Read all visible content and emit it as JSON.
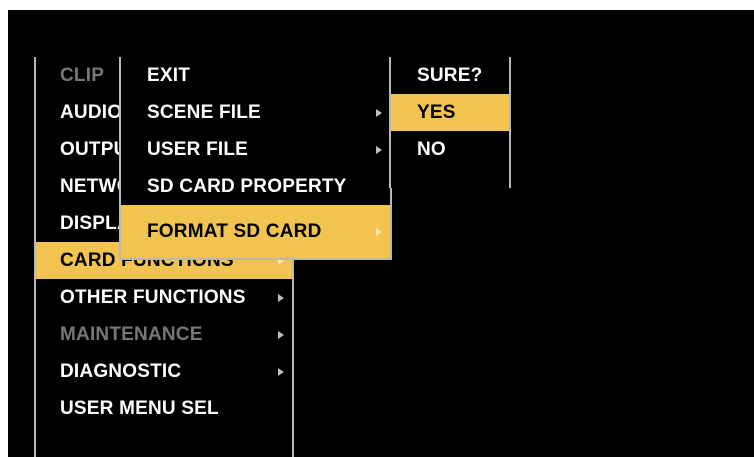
{
  "main_menu": {
    "items": [
      {
        "label": "CLIP",
        "state": "disabled",
        "has_submenu": false
      },
      {
        "label": "AUDIO",
        "state": "normal",
        "has_submenu": false
      },
      {
        "label": "OUTPUT",
        "state": "normal",
        "has_submenu": false
      },
      {
        "label": "NETWORK",
        "state": "normal",
        "has_submenu": false
      },
      {
        "label": "DISPLAY",
        "state": "normal",
        "has_submenu": false
      },
      {
        "label": "CARD FUNCTIONS",
        "state": "selected",
        "has_submenu": true
      },
      {
        "label": "OTHER FUNCTIONS",
        "state": "normal",
        "has_submenu": true
      },
      {
        "label": "MAINTENANCE",
        "state": "disabled",
        "has_submenu": true
      },
      {
        "label": "DIAGNOSTIC",
        "state": "normal",
        "has_submenu": true
      },
      {
        "label": "USER MENU SEL",
        "state": "normal",
        "has_submenu": false
      }
    ]
  },
  "card_menu": {
    "items": [
      {
        "label": "EXIT",
        "state": "normal",
        "has_submenu": false
      },
      {
        "label": "SCENE FILE",
        "state": "normal",
        "has_submenu": true
      },
      {
        "label": "USER FILE",
        "state": "normal",
        "has_submenu": true
      },
      {
        "label": "SD CARD PROPERTY",
        "state": "normal",
        "has_submenu": false
      },
      {
        "label": "FORMAT SD CARD",
        "state": "selected",
        "has_submenu": true
      }
    ]
  },
  "confirm_menu": {
    "items": [
      {
        "label": "SURE?",
        "state": "normal"
      },
      {
        "label": "YES",
        "state": "selected"
      },
      {
        "label": "NO",
        "state": "normal"
      }
    ]
  },
  "colors": {
    "background": "#000000",
    "text": "#ffffff",
    "disabled_text": "#777777",
    "selection": "#f0c44e",
    "border": "#b8b8b8"
  },
  "icons": {
    "submenu_indicator": "triangle-right-icon"
  }
}
